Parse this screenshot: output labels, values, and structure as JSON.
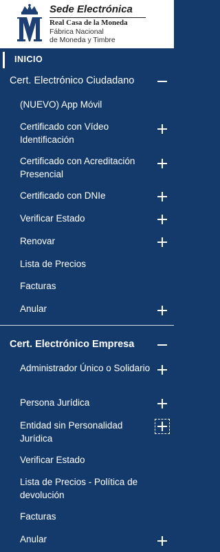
{
  "header": {
    "title": "Sede Electrónica",
    "subtitle": "Real Casa de la Moneda",
    "line1": "Fábrica Nacional",
    "line2": "de Moneda y Timbre"
  },
  "nav": {
    "inicio": "INICIO",
    "section1": {
      "title": "Cert. Electrónico Ciudadano",
      "items": [
        {
          "label": "(NUEVO) App Móvil"
        },
        {
          "label": "Certificado con Vídeo Identificación"
        },
        {
          "label": "Certificado con Acreditación Presencial"
        },
        {
          "label": "Certificado con DNIe"
        },
        {
          "label": "Verificar Estado"
        },
        {
          "label": "Renovar"
        },
        {
          "label": "Lista de Precios"
        },
        {
          "label": "Facturas"
        },
        {
          "label": "Anular"
        }
      ]
    },
    "section2": {
      "title": "Cert. Electrónico Empresa",
      "items": [
        {
          "label": "Administrador Único o Solidario"
        },
        {
          "label": "Persona Jurídica"
        },
        {
          "label": "Entidad sin Personalidad Jurídica"
        },
        {
          "label": "Verificar Estado"
        },
        {
          "label": "Lista de Precios - Política de devolución"
        },
        {
          "label": "Facturas"
        },
        {
          "label": "Anular"
        }
      ]
    }
  }
}
